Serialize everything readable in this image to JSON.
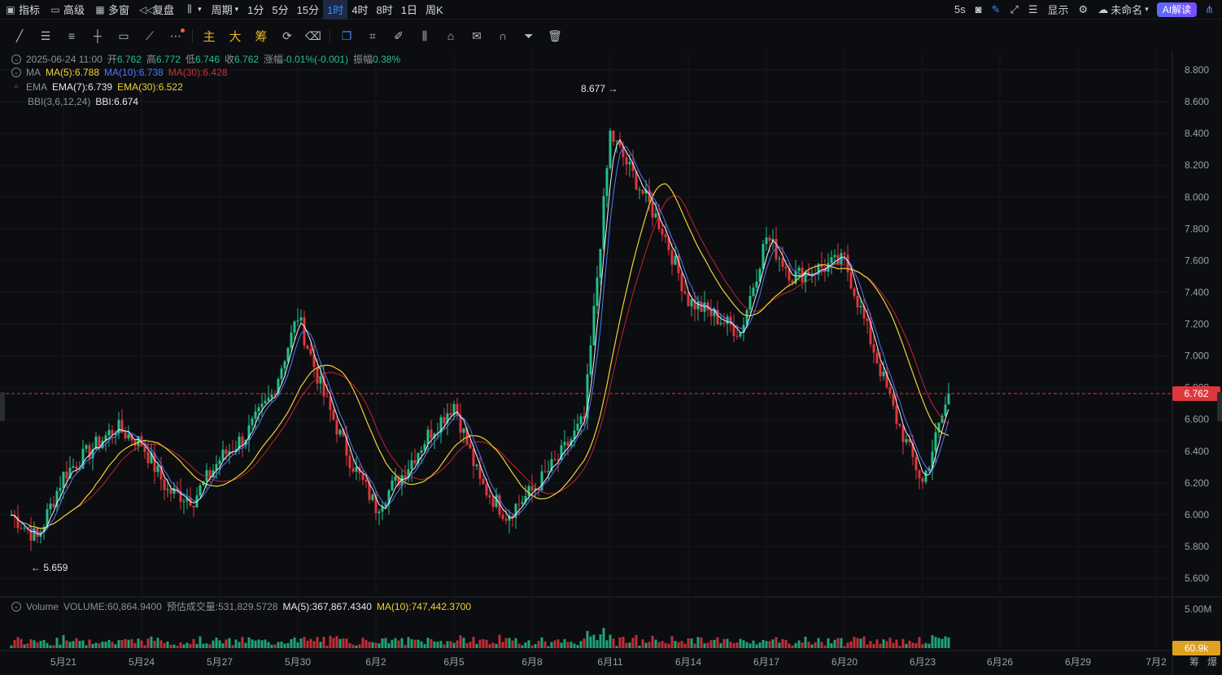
{
  "topbar": {
    "indicators": "指标",
    "advanced": "高级",
    "multi_window": "多窗",
    "replay": "复盘",
    "period": "周期",
    "periods": [
      "1分",
      "5分",
      "15分",
      "1时",
      "4时",
      "8时",
      "1日",
      "周K"
    ],
    "active_period": "1时",
    "refresh": "5s",
    "display": "显示",
    "layout_name": "未命名",
    "ai_button": "AI解读"
  },
  "toolbar": {
    "main": "主",
    "big": "大",
    "chips": "筹"
  },
  "ohlc": {
    "date": "2025-06-24 11:00",
    "open_label": "开",
    "open": "6.762",
    "high_label": "高",
    "high": "6.772",
    "low_label": "低",
    "low": "6.746",
    "close_label": "收",
    "close": "6.762",
    "change_label": "涨幅",
    "change": "-0.01%(-0.001)",
    "amplitude_label": "振幅",
    "amplitude": "0.38%"
  },
  "ma_legend": {
    "name": "MA",
    "ma5": "MA(5):6.788",
    "ma10": "MA(10):6.738",
    "ma30": "MA(30):6.428"
  },
  "ema_legend": {
    "name": "EMA",
    "ema7": "EMA(7):6.739",
    "ema30": "EMA(30):6.522"
  },
  "bbi_legend": {
    "name": "BBI(3,6,12,24)",
    "value": "BBI:6.674"
  },
  "volume_legend": {
    "name": "Volume",
    "volume": "VOLUME:60,864.9400",
    "estimated": "预估成交量:531,829.5728",
    "ma5": "MA(5):367,867.4340",
    "ma10": "MA(10):747,442.3700"
  },
  "price_axis": {
    "labels": [
      "8.800",
      "8.600",
      "8.400",
      "8.200",
      "8.000",
      "7.800",
      "7.600",
      "7.400",
      "7.200",
      "7.000",
      "6.800",
      "6.600",
      "6.400",
      "6.200",
      "6.000",
      "5.800",
      "5.600"
    ],
    "current": "6.762",
    "current_color": "#e0363e"
  },
  "volume_axis": {
    "top": "5.00M",
    "current": "60.9k",
    "current_color": "#e0a020"
  },
  "date_axis": [
    "5月21",
    "5月24",
    "5月27",
    "5月30",
    "6月2",
    "6月5",
    "6月8",
    "6月11",
    "6月14",
    "6月17",
    "6月20",
    "6月23",
    "6月26",
    "6月29",
    "7月2"
  ],
  "bottom_right": [
    "筹",
    "爆"
  ],
  "annotations": {
    "high": "8.677",
    "low": "5.659"
  },
  "colors": {
    "up": "#22c08a",
    "down": "#e0363e",
    "ma5": "#f2f2f2",
    "ma10": "#4a7bff",
    "ma30": "#c0242e",
    "ema7": "#e6e8ec",
    "ema30": "#f2d230"
  },
  "chart_data": {
    "type": "candlestick",
    "y_range": [
      5.5,
      8.85
    ],
    "x_dates": [
      "5月21",
      "5月24",
      "5月27",
      "5月30",
      "6月2",
      "6月5",
      "6月8",
      "6月11",
      "6月14",
      "6月17",
      "6月20",
      "6月23",
      "6月26",
      "6月29",
      "7月2"
    ],
    "close_trace": [
      [
        "5月19",
        6.0
      ],
      [
        "5月20",
        5.85
      ],
      [
        "5月21",
        6.25
      ],
      [
        "5月23",
        6.55
      ],
      [
        "5月24",
        6.45
      ],
      [
        "5月25",
        6.15
      ],
      [
        "5月26",
        6.1
      ],
      [
        "5月27",
        6.35
      ],
      [
        "5月28",
        6.5
      ],
      [
        "5月29",
        6.75
      ],
      [
        "5月30",
        7.25
      ],
      [
        "5月31",
        6.75
      ],
      [
        "6月1",
        6.35
      ],
      [
        "6月2",
        6.05
      ],
      [
        "6月3",
        6.25
      ],
      [
        "6月4",
        6.5
      ],
      [
        "6月5",
        6.7
      ],
      [
        "6月6",
        6.2
      ],
      [
        "6月7",
        6.0
      ],
      [
        "6月8",
        6.15
      ],
      [
        "6月9",
        6.35
      ],
      [
        "6月10",
        6.6
      ],
      [
        "6月11",
        8.4
      ],
      [
        "6月12",
        8.1
      ],
      [
        "6月13",
        7.8
      ],
      [
        "6月14",
        7.35
      ],
      [
        "6月15",
        7.25
      ],
      [
        "6月16",
        7.15
      ],
      [
        "6月17",
        7.75
      ],
      [
        "6月18",
        7.5
      ],
      [
        "6月19",
        7.55
      ],
      [
        "6月20",
        7.6
      ],
      [
        "6月21",
        7.1
      ],
      [
        "6月22",
        6.6
      ],
      [
        "6月23",
        6.2
      ],
      [
        "6月24",
        6.76
      ]
    ],
    "high": 8.677,
    "low": 5.659,
    "last": 6.762
  }
}
